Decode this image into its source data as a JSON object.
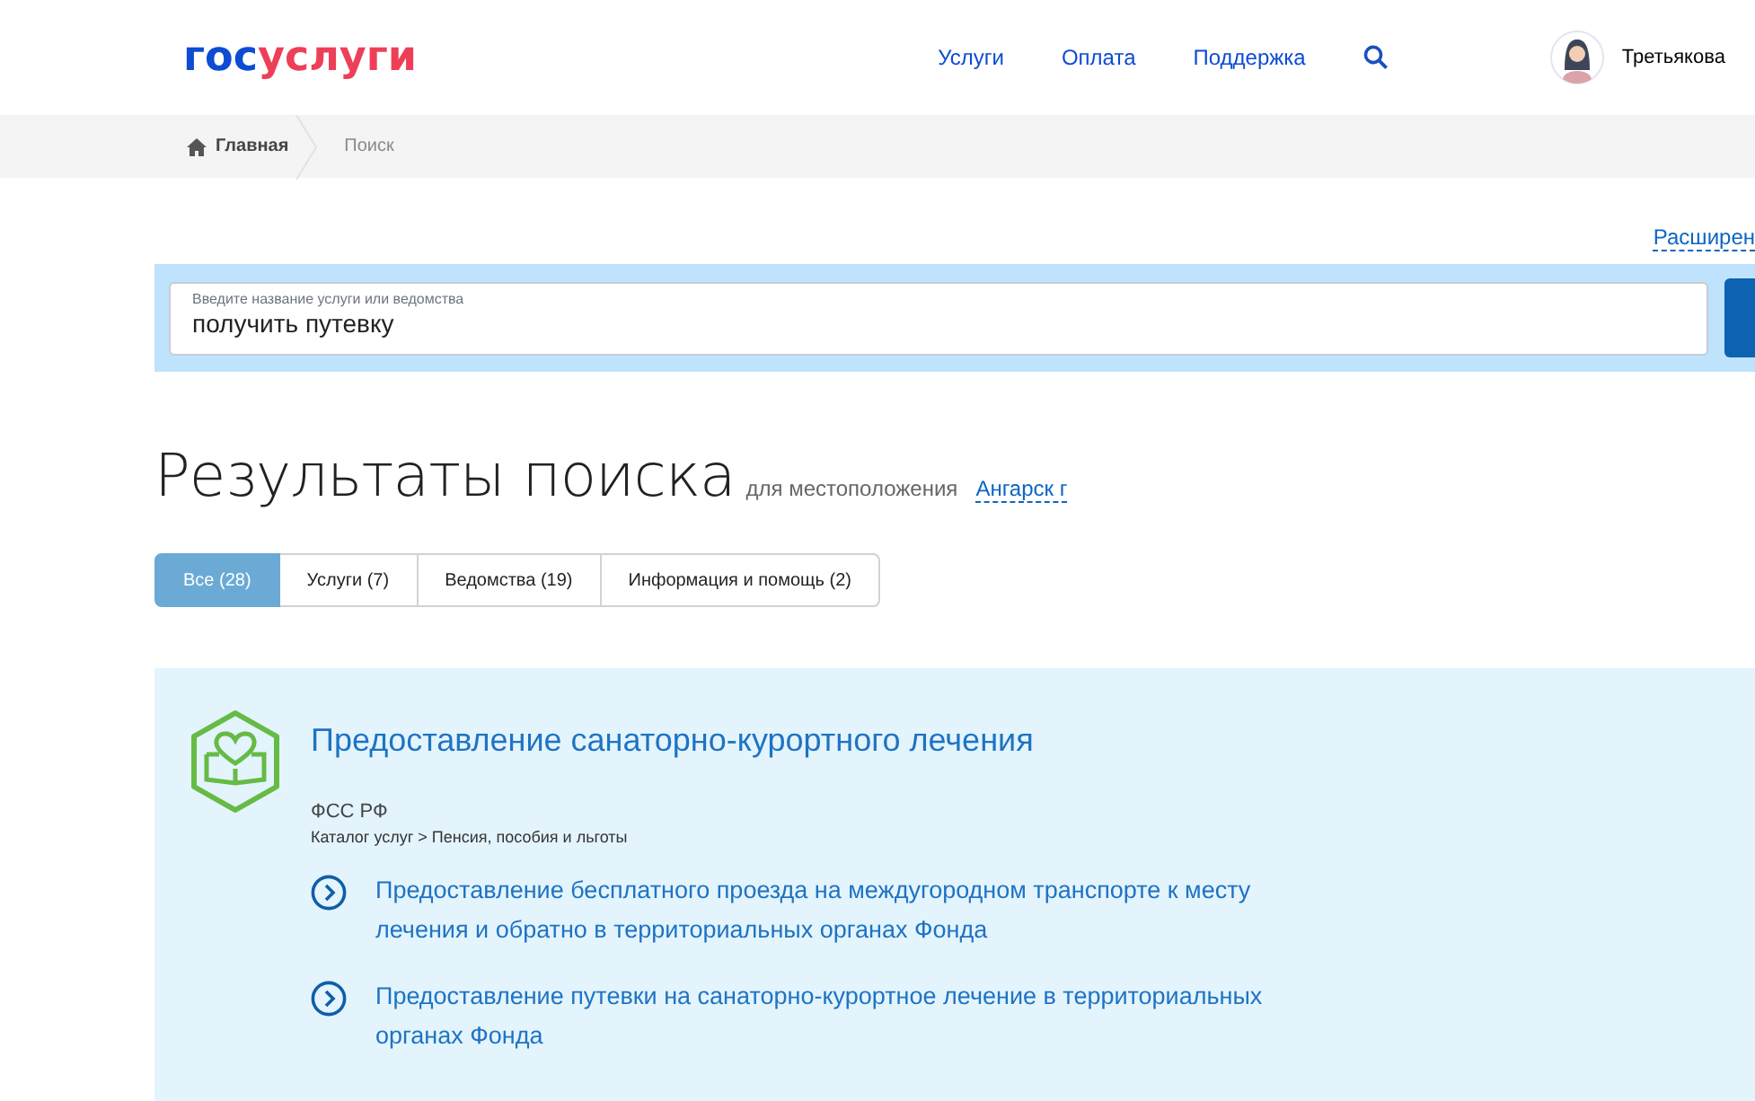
{
  "logo": {
    "prefix": "гос",
    "suffix": "услуги"
  },
  "nav": [
    "Услуги",
    "Оплата",
    "Поддержка"
  ],
  "user": {
    "name": "Третьякова"
  },
  "breadcrumbs": [
    "Главная",
    "Поиск"
  ],
  "advanced_search_link": "Расширен",
  "search": {
    "label": "Введите название услуги или ведомства",
    "value": "получить путевку"
  },
  "results": {
    "title": "Результаты поиска",
    "location_label": "для местоположения",
    "location": "Ангарск г"
  },
  "tabs": [
    {
      "label": "Все (28)",
      "selected": true
    },
    {
      "label": "Услуги (7)",
      "selected": false
    },
    {
      "label": "Ведомства (19)",
      "selected": false
    },
    {
      "label": "Информация и помощь (2)",
      "selected": false
    }
  ],
  "result_card": {
    "title": "Предоставление санаторно-курортного лечения",
    "agency": "ФСС РФ",
    "catalog_path": "Каталог услуг > Пенсия, пособия и льготы",
    "links": [
      "Предоставление бесплатного проезда на междугородном транспорте к месту лечения и обратно в территориальных органах Фонда",
      "Предоставление путевки на санаторно-курортное лечение в территориальных органах Фонда"
    ]
  }
}
